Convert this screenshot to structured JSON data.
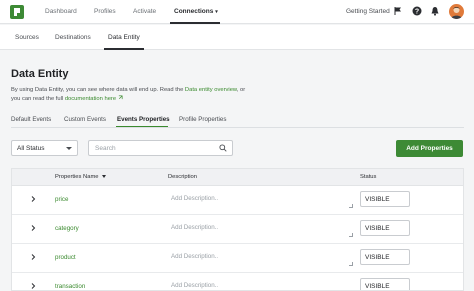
{
  "topnav": {
    "items": [
      "Dashboard",
      "Profiles",
      "Activate",
      "Connections"
    ],
    "getting_started": "Getting Started"
  },
  "subnav": {
    "items": [
      "Sources",
      "Destinations",
      "Data Entity"
    ]
  },
  "page": {
    "title": "Data Entity",
    "intro_part1": "By using Data Entity, you can see where data will end up. Read the ",
    "intro_link1": "Data entity overview",
    "intro_part2": ", or you can read the full ",
    "intro_link2": "documentation here"
  },
  "tabs": [
    "Default Events",
    "Custom Events",
    "Events Properties",
    "Profile Properties"
  ],
  "toolbar": {
    "status_filter": "All Status",
    "search_placeholder": "Search",
    "add_button": "Add Properties"
  },
  "table": {
    "columns": {
      "name": "Properties Name",
      "description": "Description",
      "status": "Status"
    },
    "description_placeholder": "Add Description..",
    "rows": [
      {
        "name": "price",
        "status": "VISIBLE"
      },
      {
        "name": "category",
        "status": "VISIBLE"
      },
      {
        "name": "product",
        "status": "VISIBLE"
      },
      {
        "name": "transaction",
        "status": "VISIBLE"
      }
    ]
  },
  "colors": {
    "accent": "#3d8a35",
    "link": "#3a8a2e",
    "avatar": "#e07a3a"
  }
}
